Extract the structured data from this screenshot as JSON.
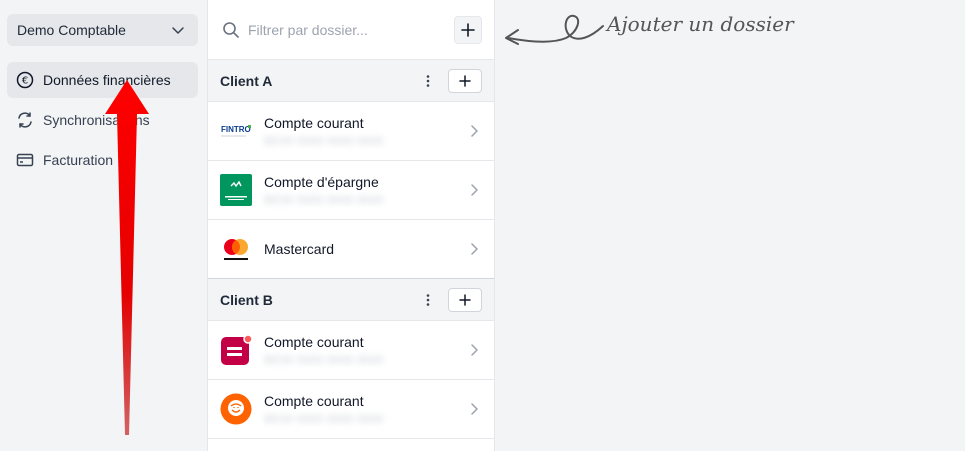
{
  "sidebar": {
    "org_name": "Demo Comptable",
    "items": [
      {
        "label": "Données financières",
        "icon": "euro-circle-icon",
        "active": true
      },
      {
        "label": "Synchronisations",
        "icon": "sync-icon",
        "active": false
      },
      {
        "label": "Facturation",
        "icon": "credit-card-icon",
        "active": false
      }
    ]
  },
  "panel": {
    "search_placeholder": "Filtrer par dossier...",
    "groups": [
      {
        "title": "Client A",
        "accounts": [
          {
            "name": "Compte courant",
            "number": "BE00 0000 0000 0000",
            "logo": "fintro-logo"
          },
          {
            "name": "Compte d'épargne",
            "number": "BE00 0000 0000 0000",
            "logo": "bnp-paribas-fortis-logo"
          },
          {
            "name": "Mastercard",
            "number": "",
            "logo": "mastercard-logo"
          }
        ]
      },
      {
        "title": "Client B",
        "accounts": [
          {
            "name": "Compte courant",
            "number": "BE00 0000 0000 0000",
            "logo": "belfius-logo"
          },
          {
            "name": "Compte courant",
            "number": "BE00 0000 0000 0000",
            "logo": "ing-lion-logo"
          }
        ]
      }
    ]
  },
  "annotation": {
    "text": "Ajouter un dossier"
  },
  "colors": {
    "arrow_red": "#e50000",
    "bnp_green": "#00965e",
    "belfius_red": "#c30045",
    "ing_orange": "#ff6200",
    "mastercard_red": "#eb001b",
    "mastercard_yellow": "#f79e1b"
  }
}
